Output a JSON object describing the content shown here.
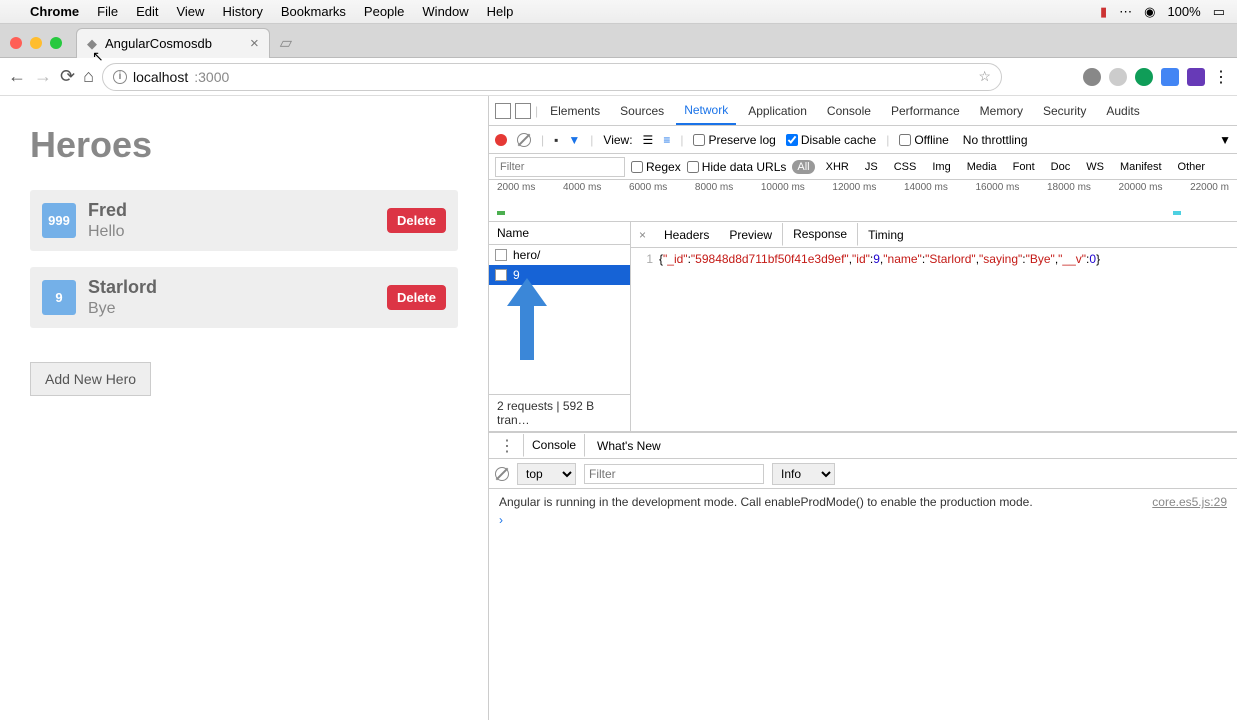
{
  "menubar": {
    "app": "Chrome",
    "items": [
      "File",
      "Edit",
      "View",
      "History",
      "Bookmarks",
      "People",
      "Window",
      "Help"
    ],
    "battery": "100%",
    "wifi": "●"
  },
  "tab": {
    "title": "AngularCosmosdb"
  },
  "address": {
    "host": "localhost",
    "port": ":3000"
  },
  "page": {
    "title": "Heroes",
    "heroes": [
      {
        "id": "999",
        "name": "Fred",
        "saying": "Hello",
        "delete": "Delete"
      },
      {
        "id": "9",
        "name": "Starlord",
        "saying": "Bye",
        "delete": "Delete"
      }
    ],
    "addButton": "Add New Hero"
  },
  "devtools": {
    "tabs": [
      "Elements",
      "Sources",
      "Network",
      "Application",
      "Console",
      "Performance",
      "Memory",
      "Security",
      "Audits"
    ],
    "activeTab": "Network",
    "toolbar": {
      "view": "View:",
      "preserve": "Preserve log",
      "disableCache": "Disable cache",
      "offline": "Offline",
      "throttle": "No throttling"
    },
    "filter": {
      "placeholder": "Filter",
      "regex": "Regex",
      "hideData": "Hide data URLs",
      "types": [
        "All",
        "XHR",
        "JS",
        "CSS",
        "Img",
        "Media",
        "Font",
        "Doc",
        "WS",
        "Manifest",
        "Other"
      ]
    },
    "timeline": [
      "2000 ms",
      "4000 ms",
      "6000 ms",
      "8000 ms",
      "10000 ms",
      "12000 ms",
      "14000 ms",
      "16000 ms",
      "18000 ms",
      "20000 ms",
      "22000 m"
    ],
    "network": {
      "nameHeader": "Name",
      "rows": [
        {
          "name": "hero/"
        },
        {
          "name": "9"
        }
      ],
      "summary": "2 requests | 592 B tran…",
      "detailTabs": [
        "Headers",
        "Preview",
        "Response",
        "Timing"
      ],
      "activeDetail": "Response",
      "response": {
        "line": "1",
        "json": {
          "_id": "59848d8d711bf50f41e3d9ef",
          "id": 9,
          "name": "Starlord",
          "saying": "Bye",
          "__v": 0
        }
      }
    },
    "console": {
      "tabs": [
        "Console",
        "What's New"
      ],
      "context": "top",
      "filterPh": "Filter",
      "level": "Info",
      "message": "Angular is running in the development mode. Call enableProdMode() to enable the production mode.",
      "source": "core.es5.js:29"
    }
  }
}
